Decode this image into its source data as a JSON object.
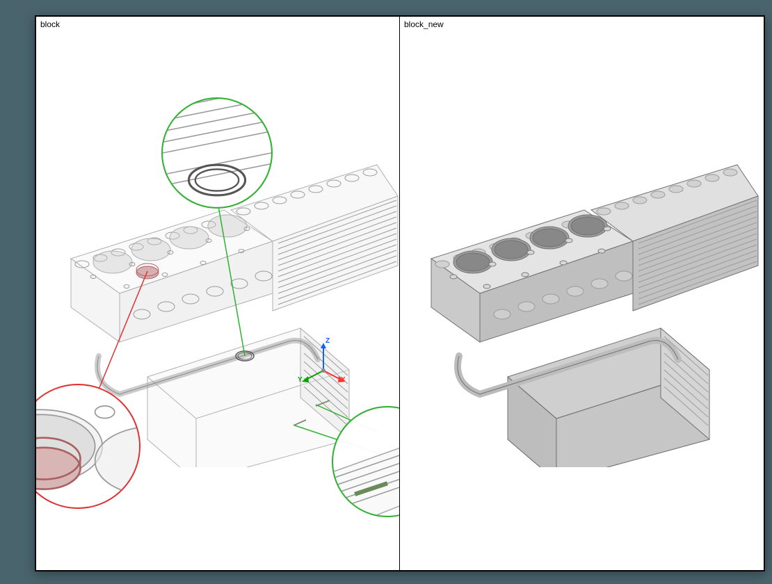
{
  "background_color": "#4a646e",
  "panes": {
    "left": {
      "title": "block",
      "render_mode": "wireframe_transparent"
    },
    "right": {
      "title": "block_new",
      "render_mode": "shaded_solid"
    }
  },
  "coordinate_triad": {
    "visible_in": "left",
    "axes": [
      {
        "label": "X",
        "direction": "right-down",
        "color": "#ff3030"
      },
      {
        "label": "Y",
        "direction": "left-down",
        "color": "#00a000"
      },
      {
        "label": "Z",
        "direction": "up",
        "color": "#1060ff"
      }
    ]
  },
  "callouts": [
    {
      "id": "c1",
      "color": "green",
      "purpose": "ring_feature_top"
    },
    {
      "id": "c2",
      "color": "green",
      "purpose": "bolt_or_slot_features_lower_right"
    },
    {
      "id": "c3",
      "color": "red",
      "purpose": "cylinder_bore_ring_insert"
    }
  ],
  "comparison_subject": "V8 engine block CAD model diff"
}
